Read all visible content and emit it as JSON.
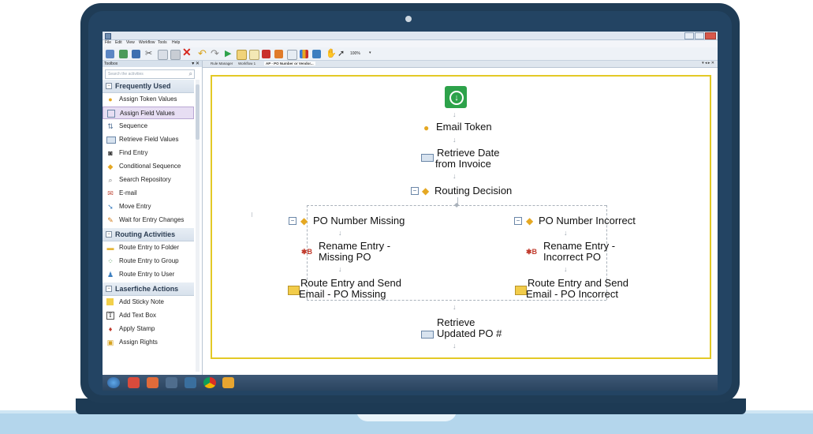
{
  "menu": [
    "File",
    "Edit",
    "View",
    "Workflow",
    "Tools",
    "Help"
  ],
  "toolbar": {
    "zoom": "100%"
  },
  "toolbox": {
    "title": "Toolbox",
    "pin": "▾ ✕",
    "search_placeholder": "Search the activities",
    "sections": [
      {
        "label": "Frequently Used",
        "items": [
          {
            "label": "Assign Token Values",
            "icon": "token-icon"
          },
          {
            "label": "Assign Field Values",
            "icon": "field-icon",
            "selected": true
          },
          {
            "label": "Sequence",
            "icon": "sequence-icon"
          },
          {
            "label": "Retrieve Field Values",
            "icon": "retrieve-icon"
          },
          {
            "label": "Find Entry",
            "icon": "binoculars-icon"
          },
          {
            "label": "Conditional Sequence",
            "icon": "conditional-icon"
          },
          {
            "label": "Search Repository",
            "icon": "search-icon"
          },
          {
            "label": "E-mail",
            "icon": "email-icon"
          },
          {
            "label": "Move Entry",
            "icon": "move-icon"
          },
          {
            "label": "Wait for Entry Changes",
            "icon": "wait-icon"
          }
        ]
      },
      {
        "label": "Routing Activities",
        "items": [
          {
            "label": "Route Entry to Folder",
            "icon": "folder-icon"
          },
          {
            "label": "Route Entry to Group",
            "icon": "group-icon"
          },
          {
            "label": "Route Entry to User",
            "icon": "user-icon"
          }
        ]
      },
      {
        "label": "Laserfiche Actions",
        "items": [
          {
            "label": "Add Sticky Note",
            "icon": "sticky-note-icon"
          },
          {
            "label": "Add Text Box",
            "icon": "text-box-icon"
          },
          {
            "label": "Apply Stamp",
            "icon": "stamp-icon"
          },
          {
            "label": "Assign Rights",
            "icon": "rights-icon"
          }
        ]
      }
    ]
  },
  "tabs": [
    "Rule Manager",
    "Workflow 1",
    "AP - PO Number or Vendor..."
  ],
  "tab_nav": "▾ ◂ ▸ ✕",
  "workflow": {
    "email_token": "Email Token",
    "retrieve_date": [
      "Retrieve Date",
      "from Invoice"
    ],
    "routing_decision": "Routing Decision",
    "left_branch": {
      "title": "PO Number Missing",
      "rename": [
        "Rename Entry -",
        "Missing PO"
      ],
      "route": [
        "Route Entry and Send",
        "Email - PO Missing"
      ]
    },
    "right_branch": {
      "title": "PO Number Incorrect",
      "rename": [
        "Rename Entry -",
        "Incorrect PO"
      ],
      "route": [
        "Route Entry and Send",
        "Email - PO Incorrect"
      ]
    },
    "retrieve_po": [
      "Retrieve",
      "Updated PO #"
    ]
  },
  "colors": {
    "bezel": "#1f3c56",
    "canvas_border": "#e3c926",
    "start": "#2da24a",
    "selection": "#e7def3"
  }
}
